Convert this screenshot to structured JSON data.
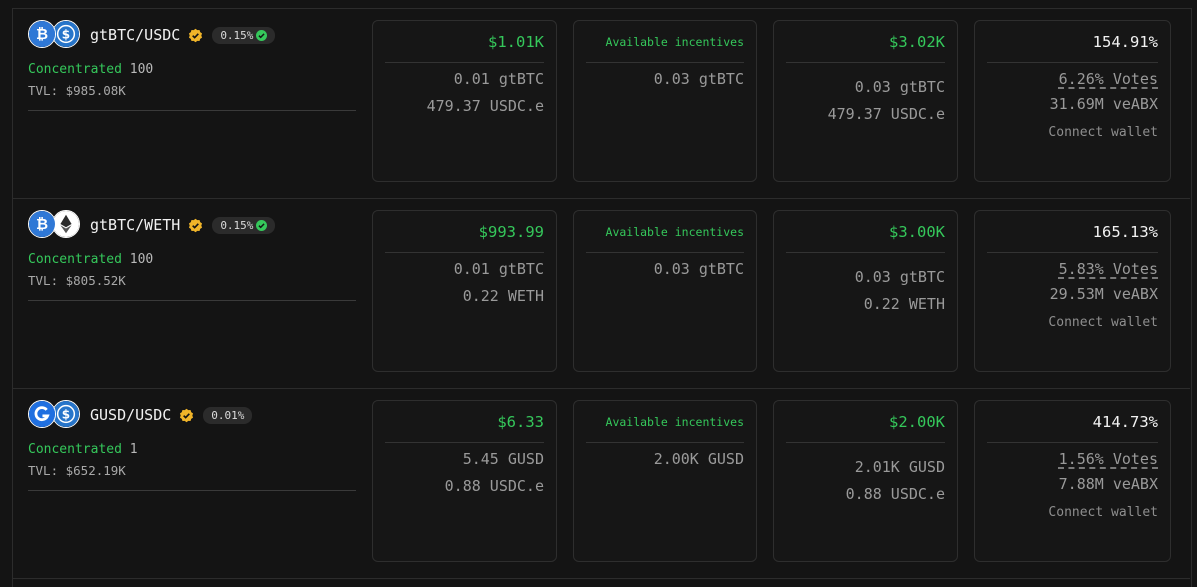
{
  "colors": {
    "green": "#35c85b",
    "gold": "#f0b429",
    "background": "#141414"
  },
  "pools": [
    {
      "pair": "gtBTC/USDC",
      "icons": [
        "bitcoin-icon",
        "usdc-icon"
      ],
      "fee": "0.15%",
      "fee_check": true,
      "type_label": "Concentrated",
      "type_value": "100",
      "tvl": "TVL: $985.08K",
      "volume": {
        "total": "$1.01K",
        "line1": "0.01 gtBTC",
        "line2": "479.37 USDC.e"
      },
      "incentives": {
        "label": "Available incentives",
        "line1": "0.03 gtBTC"
      },
      "fees": {
        "total": "$3.02K",
        "line1": "0.03 gtBTC",
        "line2": "479.37 USDC.e"
      },
      "apr": {
        "total": "154.91%",
        "votes": "6.26% Votes",
        "veabx": "31.69M veABX",
        "connect": "Connect wallet"
      }
    },
    {
      "pair": "gtBTC/WETH",
      "icons": [
        "bitcoin-icon",
        "ethereum-icon"
      ],
      "fee": "0.15%",
      "fee_check": true,
      "type_label": "Concentrated",
      "type_value": "100",
      "tvl": "TVL: $805.52K",
      "volume": {
        "total": "$993.99",
        "line1": "0.01 gtBTC",
        "line2": "0.22 WETH"
      },
      "incentives": {
        "label": "Available incentives",
        "line1": "0.03 gtBTC"
      },
      "fees": {
        "total": "$3.00K",
        "line1": "0.03 gtBTC",
        "line2": "0.22 WETH"
      },
      "apr": {
        "total": "165.13%",
        "votes": "5.83% Votes",
        "veabx": "29.53M veABX",
        "connect": "Connect wallet"
      }
    },
    {
      "pair": "GUSD/USDC",
      "icons": [
        "gusd-icon",
        "usdc-icon"
      ],
      "fee": "0.01%",
      "fee_check": false,
      "type_label": "Concentrated",
      "type_value": "1",
      "tvl": "TVL: $652.19K",
      "volume": {
        "total": "$6.33",
        "line1": "5.45 GUSD",
        "line2": "0.88 USDC.e"
      },
      "incentives": {
        "label": "Available incentives",
        "line1": "2.00K GUSD"
      },
      "fees": {
        "total": "$2.00K",
        "line1": "2.01K GUSD",
        "line2": "0.88 USDC.e"
      },
      "apr": {
        "total": "414.73%",
        "votes": "1.56% Votes",
        "veabx": "7.88M veABX",
        "connect": "Connect wallet"
      }
    }
  ]
}
